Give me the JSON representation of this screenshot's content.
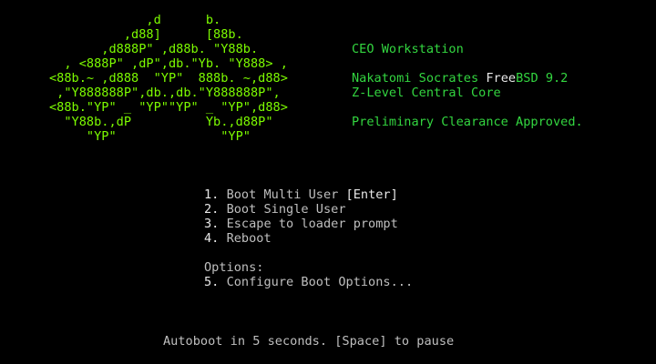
{
  "colors": {
    "background": "#000000",
    "logo": "#7dfc00",
    "info": "#33d640",
    "text": "#bfbfbf",
    "highlight": "#e8e8e8"
  },
  "logo": {
    "lines": [
      "             ,d      b.",
      "          ,d88]      [88b.",
      "       ,d888P\" ,d88b. \"Y88b.",
      "  , <888P\" ,dP\",db.\"Yb. \"Y888> ,",
      "<88b.~ ,d888  \"YP\"  888b. ~,d88>",
      " ,\"Y888888P\",db.,db.\"Y888888P\",",
      "<88b.\"YP\" _ \"YP\"\"YP\" _ \"YP\",d88>",
      "  \"Y88b.,dP          Yb.,d88P\"",
      "     \"YP\"              \"YP\""
    ]
  },
  "info": {
    "title": "CEO Workstation",
    "os_prefix": "Nakatomi Socrates ",
    "os_highlight": "Free",
    "os_suffix": "BSD 9.2",
    "core": "Z-Level Central Core",
    "clearance": "Preliminary Clearance Approved."
  },
  "menu": {
    "items": [
      {
        "number": "1.",
        "label": "Boot Multi User ",
        "key": "[Enter]"
      },
      {
        "number": "2.",
        "label": "Boot Single User",
        "key": ""
      },
      {
        "number": "3.",
        "label": "Escape to loader prompt",
        "key": ""
      },
      {
        "number": "4.",
        "label": "Reboot",
        "key": ""
      }
    ],
    "options_heading": "Options:",
    "options": [
      {
        "number": "5.",
        "label": "Configure Boot Options...",
        "key": ""
      }
    ]
  },
  "footer": {
    "autoboot": "Autoboot in 5 seconds. [Space] to pause"
  }
}
